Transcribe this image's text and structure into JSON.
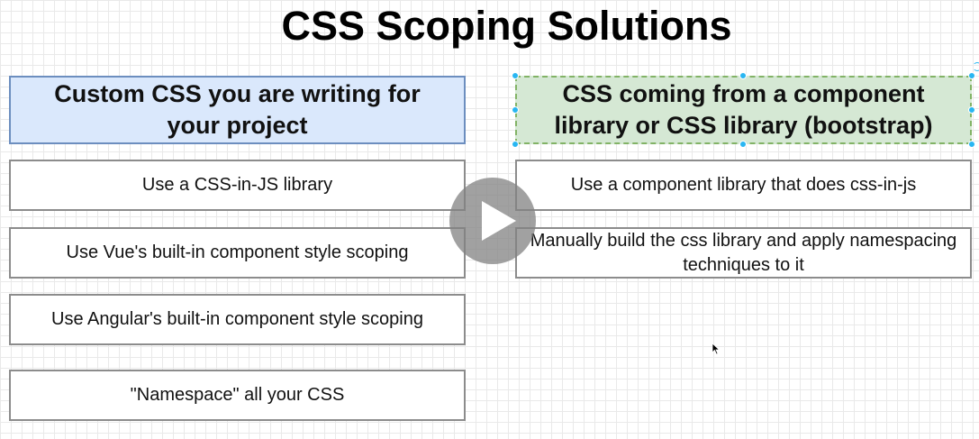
{
  "title": "CSS Scoping Solutions",
  "left_column": {
    "header": "Custom CSS you are writing for your project",
    "items": [
      "Use a CSS-in-JS library",
      "Use Vue's built-in component style scoping",
      "Use Angular's built-in component style scoping",
      "\"Namespace\" all your CSS"
    ]
  },
  "right_column": {
    "header": "CSS coming from a component library or CSS library (bootstrap)",
    "items": [
      "Use a component library that does css-in-js",
      "Manually build the css library and apply namespacing techniques to it"
    ]
  },
  "colors": {
    "left_header_fill": "#dae8fc",
    "left_header_border": "#6c8ebf",
    "right_header_fill": "#d5e8d4",
    "right_header_border": "#82b366",
    "selection_handle": "#29b6f2"
  },
  "icons": {
    "video_control": "play-icon",
    "pointer": "cursor-icon"
  }
}
